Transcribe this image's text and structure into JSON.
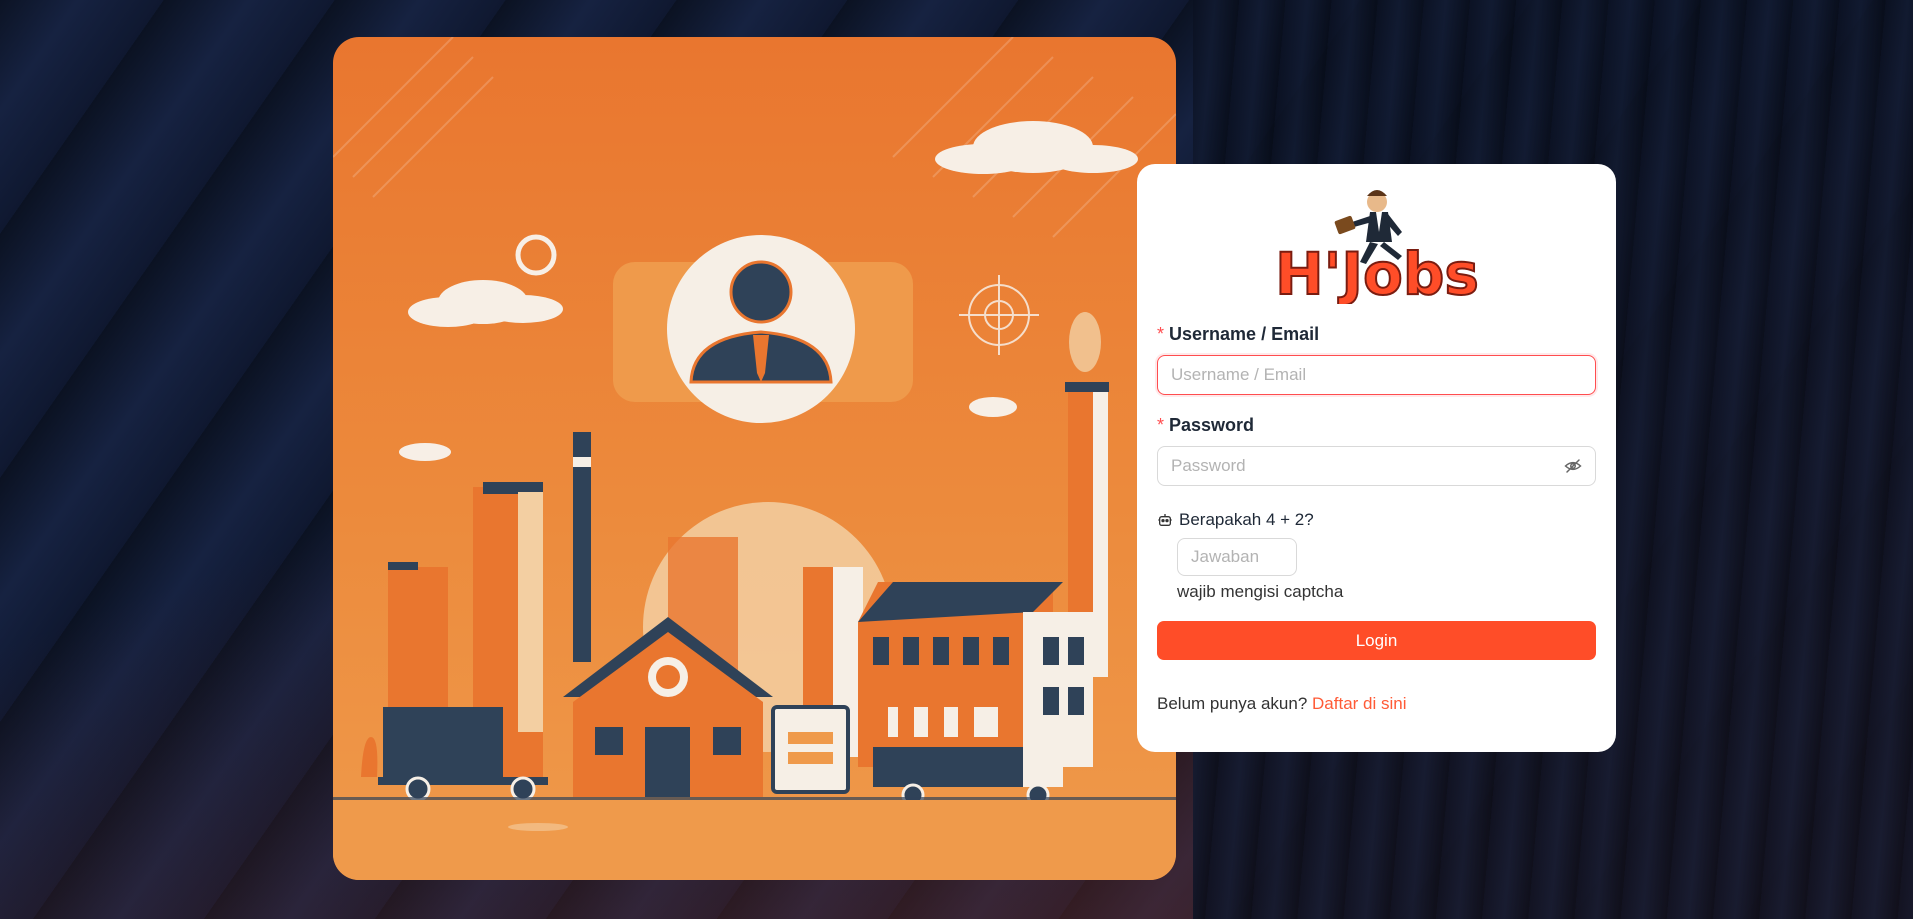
{
  "brand": {
    "logo_text": "H'Jobs",
    "primary_color": "#ff4d28",
    "link_color": "#ff5a36",
    "error_color": "#ff4d4f"
  },
  "illustration": {
    "description_icon": "factory-city-illustration",
    "avatar_icon": "user-avatar-icon"
  },
  "login_form": {
    "username": {
      "label": "Username / Email",
      "required_marker": "*",
      "placeholder": "Username / Email",
      "value": ""
    },
    "password": {
      "label": "Password",
      "required_marker": "*",
      "placeholder": "Password",
      "value": "",
      "toggle_icon": "eye-off-icon"
    },
    "captcha": {
      "icon": "robot-icon",
      "question": "Berapakah 4 + 2?",
      "placeholder": "Jawaban",
      "value": "",
      "help_text": "wajib mengisi captcha"
    },
    "submit_label": "Login",
    "signup": {
      "prompt": "Belum punya akun?",
      "link_label": "Daftar di sini"
    }
  }
}
